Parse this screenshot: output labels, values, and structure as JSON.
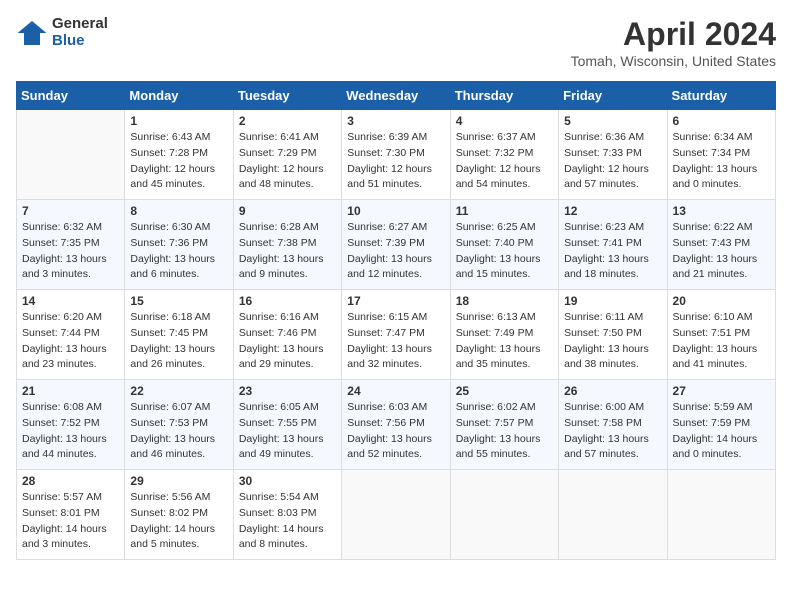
{
  "logo": {
    "general": "General",
    "blue": "Blue"
  },
  "title": "April 2024",
  "location": "Tomah, Wisconsin, United States",
  "days_of_week": [
    "Sunday",
    "Monday",
    "Tuesday",
    "Wednesday",
    "Thursday",
    "Friday",
    "Saturday"
  ],
  "weeks": [
    [
      {
        "day": "",
        "sunrise": "",
        "sunset": "",
        "daylight": ""
      },
      {
        "day": "1",
        "sunrise": "Sunrise: 6:43 AM",
        "sunset": "Sunset: 7:28 PM",
        "daylight": "Daylight: 12 hours and 45 minutes."
      },
      {
        "day": "2",
        "sunrise": "Sunrise: 6:41 AM",
        "sunset": "Sunset: 7:29 PM",
        "daylight": "Daylight: 12 hours and 48 minutes."
      },
      {
        "day": "3",
        "sunrise": "Sunrise: 6:39 AM",
        "sunset": "Sunset: 7:30 PM",
        "daylight": "Daylight: 12 hours and 51 minutes."
      },
      {
        "day": "4",
        "sunrise": "Sunrise: 6:37 AM",
        "sunset": "Sunset: 7:32 PM",
        "daylight": "Daylight: 12 hours and 54 minutes."
      },
      {
        "day": "5",
        "sunrise": "Sunrise: 6:36 AM",
        "sunset": "Sunset: 7:33 PM",
        "daylight": "Daylight: 12 hours and 57 minutes."
      },
      {
        "day": "6",
        "sunrise": "Sunrise: 6:34 AM",
        "sunset": "Sunset: 7:34 PM",
        "daylight": "Daylight: 13 hours and 0 minutes."
      }
    ],
    [
      {
        "day": "7",
        "sunrise": "Sunrise: 6:32 AM",
        "sunset": "Sunset: 7:35 PM",
        "daylight": "Daylight: 13 hours and 3 minutes."
      },
      {
        "day": "8",
        "sunrise": "Sunrise: 6:30 AM",
        "sunset": "Sunset: 7:36 PM",
        "daylight": "Daylight: 13 hours and 6 minutes."
      },
      {
        "day": "9",
        "sunrise": "Sunrise: 6:28 AM",
        "sunset": "Sunset: 7:38 PM",
        "daylight": "Daylight: 13 hours and 9 minutes."
      },
      {
        "day": "10",
        "sunrise": "Sunrise: 6:27 AM",
        "sunset": "Sunset: 7:39 PM",
        "daylight": "Daylight: 13 hours and 12 minutes."
      },
      {
        "day": "11",
        "sunrise": "Sunrise: 6:25 AM",
        "sunset": "Sunset: 7:40 PM",
        "daylight": "Daylight: 13 hours and 15 minutes."
      },
      {
        "day": "12",
        "sunrise": "Sunrise: 6:23 AM",
        "sunset": "Sunset: 7:41 PM",
        "daylight": "Daylight: 13 hours and 18 minutes."
      },
      {
        "day": "13",
        "sunrise": "Sunrise: 6:22 AM",
        "sunset": "Sunset: 7:43 PM",
        "daylight": "Daylight: 13 hours and 21 minutes."
      }
    ],
    [
      {
        "day": "14",
        "sunrise": "Sunrise: 6:20 AM",
        "sunset": "Sunset: 7:44 PM",
        "daylight": "Daylight: 13 hours and 23 minutes."
      },
      {
        "day": "15",
        "sunrise": "Sunrise: 6:18 AM",
        "sunset": "Sunset: 7:45 PM",
        "daylight": "Daylight: 13 hours and 26 minutes."
      },
      {
        "day": "16",
        "sunrise": "Sunrise: 6:16 AM",
        "sunset": "Sunset: 7:46 PM",
        "daylight": "Daylight: 13 hours and 29 minutes."
      },
      {
        "day": "17",
        "sunrise": "Sunrise: 6:15 AM",
        "sunset": "Sunset: 7:47 PM",
        "daylight": "Daylight: 13 hours and 32 minutes."
      },
      {
        "day": "18",
        "sunrise": "Sunrise: 6:13 AM",
        "sunset": "Sunset: 7:49 PM",
        "daylight": "Daylight: 13 hours and 35 minutes."
      },
      {
        "day": "19",
        "sunrise": "Sunrise: 6:11 AM",
        "sunset": "Sunset: 7:50 PM",
        "daylight": "Daylight: 13 hours and 38 minutes."
      },
      {
        "day": "20",
        "sunrise": "Sunrise: 6:10 AM",
        "sunset": "Sunset: 7:51 PM",
        "daylight": "Daylight: 13 hours and 41 minutes."
      }
    ],
    [
      {
        "day": "21",
        "sunrise": "Sunrise: 6:08 AM",
        "sunset": "Sunset: 7:52 PM",
        "daylight": "Daylight: 13 hours and 44 minutes."
      },
      {
        "day": "22",
        "sunrise": "Sunrise: 6:07 AM",
        "sunset": "Sunset: 7:53 PM",
        "daylight": "Daylight: 13 hours and 46 minutes."
      },
      {
        "day": "23",
        "sunrise": "Sunrise: 6:05 AM",
        "sunset": "Sunset: 7:55 PM",
        "daylight": "Daylight: 13 hours and 49 minutes."
      },
      {
        "day": "24",
        "sunrise": "Sunrise: 6:03 AM",
        "sunset": "Sunset: 7:56 PM",
        "daylight": "Daylight: 13 hours and 52 minutes."
      },
      {
        "day": "25",
        "sunrise": "Sunrise: 6:02 AM",
        "sunset": "Sunset: 7:57 PM",
        "daylight": "Daylight: 13 hours and 55 minutes."
      },
      {
        "day": "26",
        "sunrise": "Sunrise: 6:00 AM",
        "sunset": "Sunset: 7:58 PM",
        "daylight": "Daylight: 13 hours and 57 minutes."
      },
      {
        "day": "27",
        "sunrise": "Sunrise: 5:59 AM",
        "sunset": "Sunset: 7:59 PM",
        "daylight": "Daylight: 14 hours and 0 minutes."
      }
    ],
    [
      {
        "day": "28",
        "sunrise": "Sunrise: 5:57 AM",
        "sunset": "Sunset: 8:01 PM",
        "daylight": "Daylight: 14 hours and 3 minutes."
      },
      {
        "day": "29",
        "sunrise": "Sunrise: 5:56 AM",
        "sunset": "Sunset: 8:02 PM",
        "daylight": "Daylight: 14 hours and 5 minutes."
      },
      {
        "day": "30",
        "sunrise": "Sunrise: 5:54 AM",
        "sunset": "Sunset: 8:03 PM",
        "daylight": "Daylight: 14 hours and 8 minutes."
      },
      {
        "day": "",
        "sunrise": "",
        "sunset": "",
        "daylight": ""
      },
      {
        "day": "",
        "sunrise": "",
        "sunset": "",
        "daylight": ""
      },
      {
        "day": "",
        "sunrise": "",
        "sunset": "",
        "daylight": ""
      },
      {
        "day": "",
        "sunrise": "",
        "sunset": "",
        "daylight": ""
      }
    ]
  ]
}
